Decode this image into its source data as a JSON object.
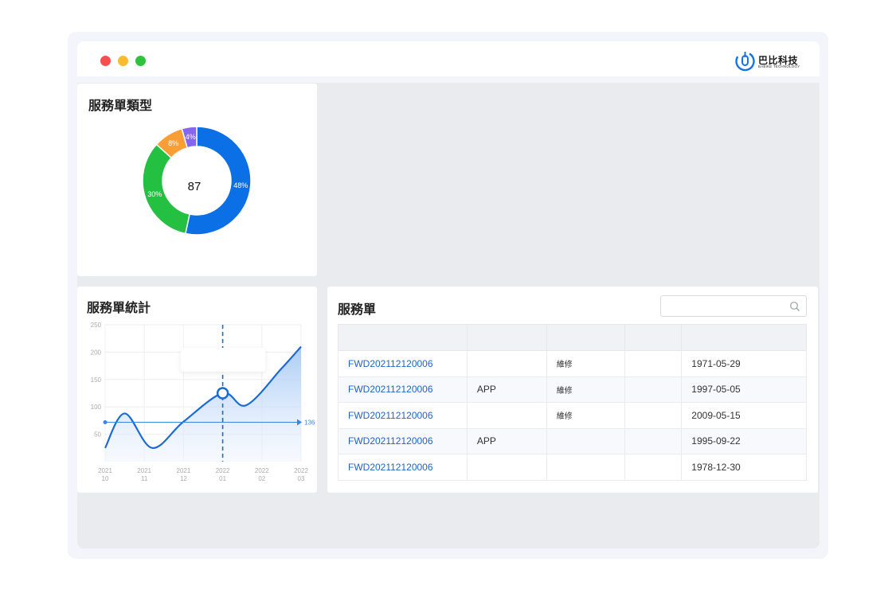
{
  "window": {
    "controls": [
      {
        "name": "close",
        "color": "#f5504d"
      },
      {
        "name": "minimize",
        "color": "#fbbb2f"
      },
      {
        "name": "maximize",
        "color": "#2fc23f"
      }
    ],
    "brand": {
      "name": "巴比科技",
      "tagline": "BABIKE TECHNOLOGY",
      "color": "#1673e6"
    }
  },
  "type_card": {
    "title": "服務單類型",
    "center_value": "87",
    "chart_data": {
      "type": "pie",
      "donut": true,
      "slices": [
        {
          "label": "48%",
          "value": 48,
          "color": "#0b6fe5"
        },
        {
          "label": "30%",
          "value": 30,
          "color": "#23c042"
        },
        {
          "label": "8%",
          "value": 8,
          "color": "#f99d35"
        },
        {
          "label": "4%",
          "value": 4,
          "color": "#8665f3"
        }
      ]
    }
  },
  "stats_card": {
    "title": "服務單統計",
    "chart_data": {
      "type": "area",
      "x_ticks": [
        {
          "top": "2021",
          "bottom": "10"
        },
        {
          "top": "2021",
          "bottom": "11"
        },
        {
          "top": "2021",
          "bottom": "12"
        },
        {
          "top": "2022",
          "bottom": "01"
        },
        {
          "top": "2022",
          "bottom": "02"
        },
        {
          "top": "2022",
          "bottom": "03"
        }
      ],
      "y_ticks": [
        250,
        200,
        150,
        100,
        50
      ],
      "ylim": [
        0,
        250
      ],
      "points": [
        {
          "x": 0.0,
          "y": 25
        },
        {
          "x": 0.5,
          "y": 88
        },
        {
          "x": 1.2,
          "y": 25
        },
        {
          "x": 2.0,
          "y": 73
        },
        {
          "x": 3.0,
          "y": 125
        },
        {
          "x": 3.6,
          "y": 103
        },
        {
          "x": 4.5,
          "y": 170
        },
        {
          "x": 5.0,
          "y": 210
        }
      ],
      "reference_line": {
        "value": 72,
        "label": "136"
      },
      "highlight": {
        "x": 3.0,
        "y": 125
      },
      "line_color": "#1a6bd6",
      "grid": true
    }
  },
  "orders_card": {
    "title": "服務單",
    "search": {
      "placeholder": "",
      "value": ""
    },
    "columns": [
      "",
      "",
      "",
      "",
      ""
    ],
    "rows": [
      [
        "FWD202112120006",
        "",
        "維修",
        "",
        "1971-05-29"
      ],
      [
        "FWD202112120006",
        "APP",
        "維修",
        "",
        "1997-05-05"
      ],
      [
        "FWD202112120006",
        "",
        "維修",
        "",
        "2009-05-15"
      ],
      [
        "FWD202112120006",
        "APP",
        "",
        "",
        "1995-09-22"
      ],
      [
        "FWD202112120006",
        "",
        "",
        "",
        "1978-12-30"
      ]
    ]
  }
}
